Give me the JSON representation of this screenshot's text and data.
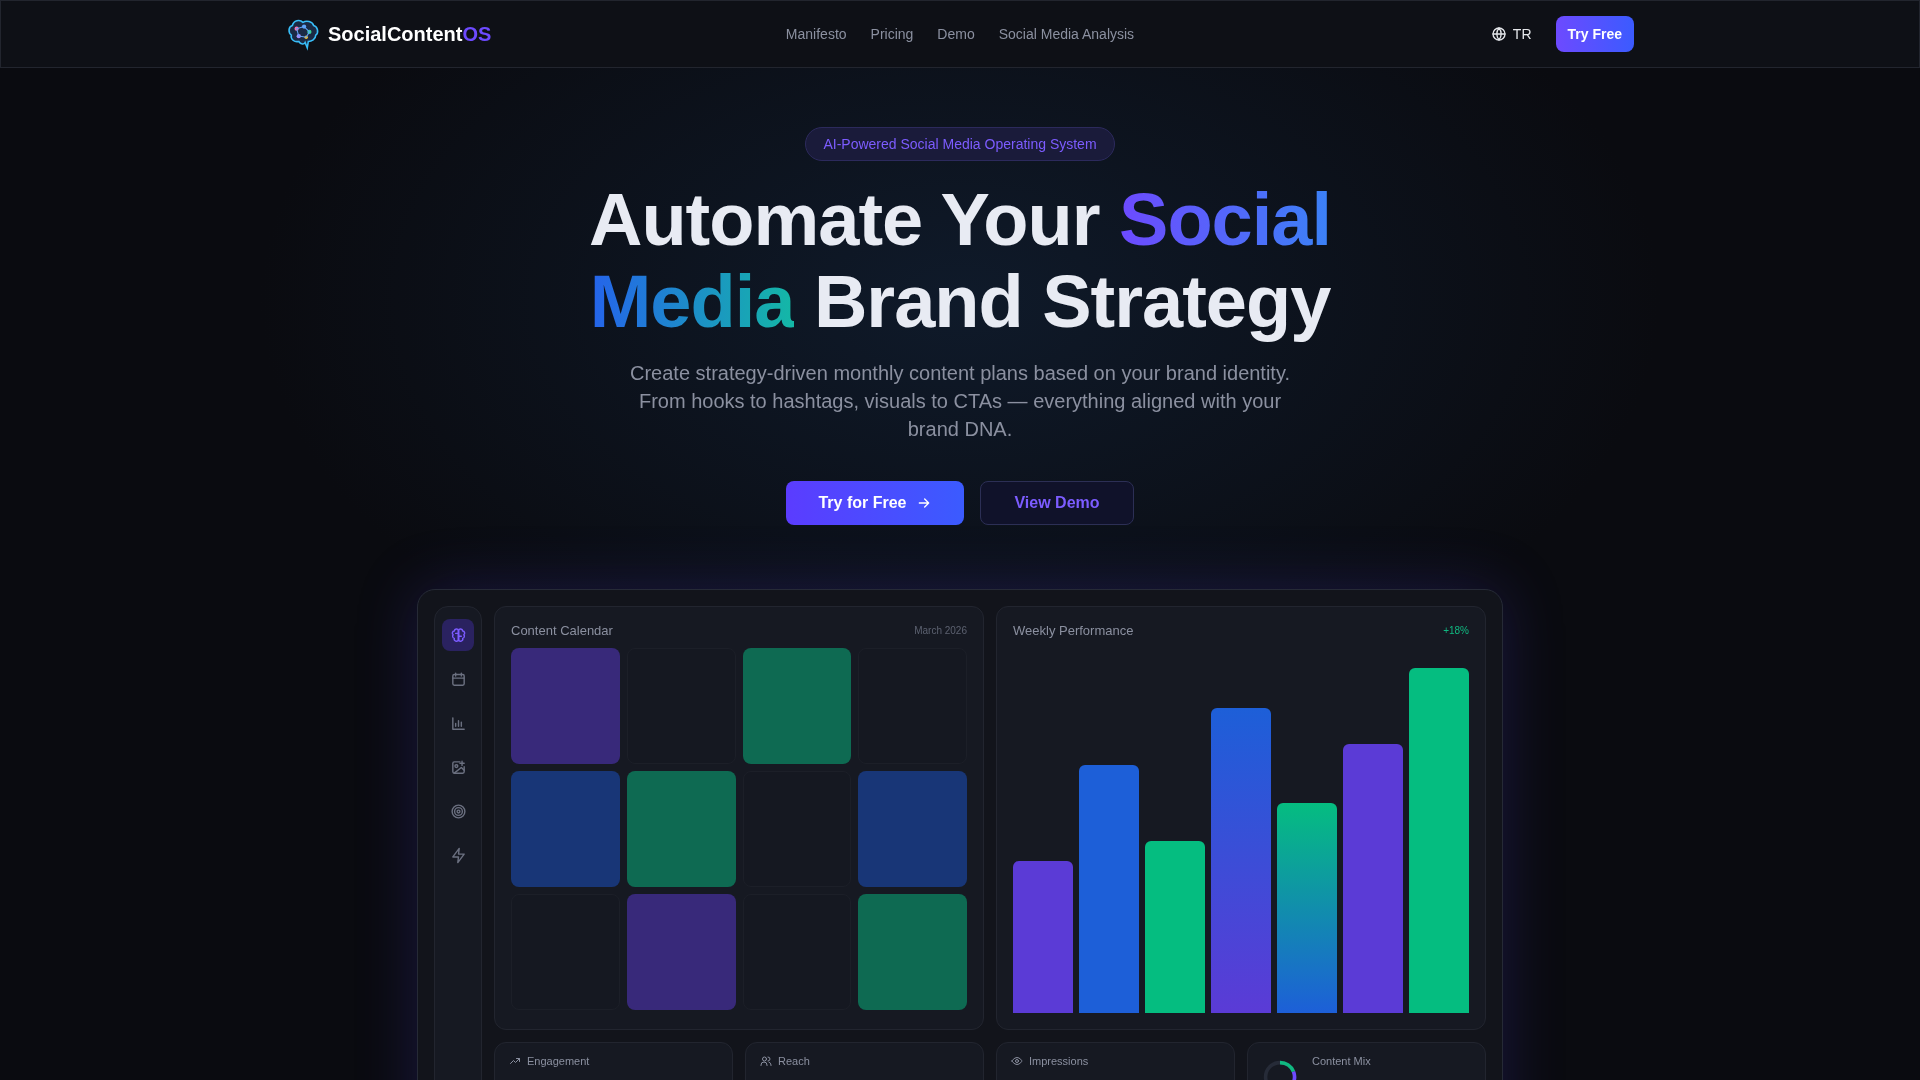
{
  "header": {
    "brand": {
      "name": "SocialContent",
      "suffix": "OS"
    },
    "nav": [
      "Manifesto",
      "Pricing",
      "Demo",
      "Social Media Analysis"
    ],
    "language": "TR",
    "cta": "Try Free"
  },
  "hero": {
    "badge": "AI-Powered Social Media Operating System",
    "title": {
      "line1": "Automate Your ",
      "accent1": "Social",
      "accent2": "Media",
      "line2": " Brand Strategy"
    },
    "subtitle": "Create strategy-driven monthly content plans based on your brand identity. From hooks to hashtags, visuals to CTAs — everything aligned with your brand DNA.",
    "buttons": [
      {
        "label": "Try for Free",
        "kind": "primary"
      },
      {
        "label": "View Demo",
        "kind": "secondary"
      }
    ]
  },
  "dashboard": {
    "sidebar": [
      {
        "selected": true
      },
      {
        "selected": false
      },
      {
        "selected": false
      },
      {
        "selected": false
      },
      {
        "selected": false
      },
      {
        "selected": false
      }
    ],
    "calendar": {
      "title": "Content Calendar",
      "month": "March 2026",
      "cells": [
        {
          "kind": "post",
          "color": "#38297a"
        },
        {
          "kind": "empty"
        },
        {
          "kind": "post",
          "color": "#0e6a52"
        },
        {
          "kind": "empty"
        },
        {
          "kind": "post",
          "color": "#183677"
        },
        {
          "kind": "post",
          "color": "#0e6a52"
        },
        {
          "kind": "empty"
        },
        {
          "kind": "post",
          "color": "#183677"
        },
        {
          "kind": "empty"
        },
        {
          "kind": "post",
          "color": "#38297a"
        },
        {
          "kind": "empty"
        },
        {
          "kind": "post",
          "color": "#0e6a52"
        }
      ]
    },
    "performance": {
      "title": "Weekly Performance",
      "change": "+18%"
    },
    "stats": [
      {
        "label": "Engagement",
        "kind": "metric"
      },
      {
        "label": "Reach",
        "kind": "metric"
      },
      {
        "label": "Impressions",
        "kind": "metric"
      },
      {
        "label": "Content Mix",
        "kind": "mix"
      }
    ]
  }
}
